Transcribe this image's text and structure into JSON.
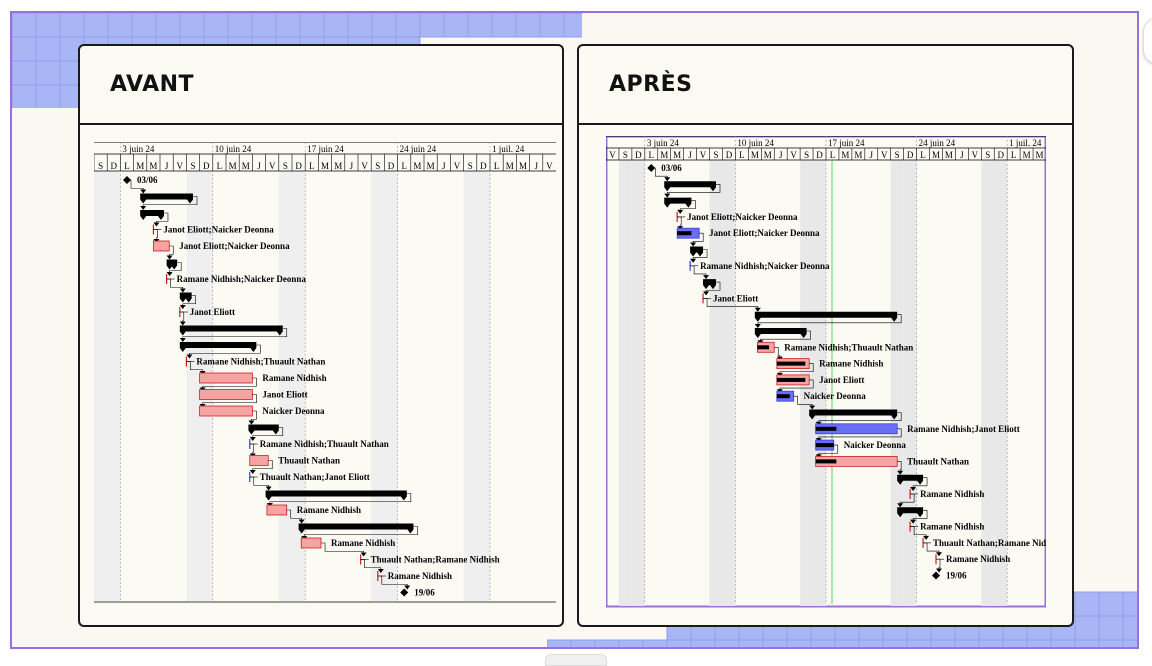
{
  "panels": {
    "before": {
      "title": "AVANT"
    },
    "after": {
      "title": "APRÈS"
    }
  },
  "timeline": {
    "weeks": [
      "3 juin 24",
      "10 juin 24",
      "17 juin 24",
      "24 juin 24",
      "1 juil. 24"
    ],
    "before_days": [
      "S",
      "D",
      "L",
      "M",
      "M",
      "J",
      "V",
      "S",
      "D",
      "L",
      "M",
      "M",
      "J",
      "V",
      "S",
      "D",
      "L",
      "M",
      "M",
      "J",
      "V",
      "S",
      "D",
      "L",
      "M",
      "M",
      "J",
      "V",
      "S",
      "D",
      "L",
      "M",
      "M",
      "J",
      "V"
    ],
    "after_days": [
      "V",
      "S",
      "D",
      "L",
      "M",
      "M",
      "J",
      "V",
      "S",
      "D",
      "L",
      "M",
      "M",
      "J",
      "V",
      "S",
      "D",
      "L",
      "M",
      "M",
      "J",
      "V",
      "S",
      "D",
      "L",
      "M",
      "M",
      "J",
      "V",
      "S",
      "D",
      "L",
      "M",
      "M"
    ]
  },
  "colors": {
    "accent_purple": "#9b6ee0",
    "deco_blue": "#a9b6f5",
    "task_pink": "#f5a3a3",
    "task_red_outline": "#cc2020",
    "task_blue": "#3a3ee0",
    "today_line_green": "#33cc33"
  },
  "before_rows": [
    {
      "type": "milestone",
      "label": "03/06"
    },
    {
      "type": "summary"
    },
    {
      "type": "summary"
    },
    {
      "type": "tick",
      "label": "Janot Eliott;Naicker Deonna"
    },
    {
      "type": "bar",
      "label": "Janot Eliott;Naicker Deonna"
    },
    {
      "type": "summary"
    },
    {
      "type": "tick",
      "label": "Ramane Nidhish;Naicker Deonna"
    },
    {
      "type": "summary"
    },
    {
      "type": "tick",
      "label": "Janot Eliott"
    },
    {
      "type": "summary"
    },
    {
      "type": "summary"
    },
    {
      "type": "tick",
      "label": "Ramane Nidhish;Thuault Nathan"
    },
    {
      "type": "bar",
      "label": "Ramane Nidhish"
    },
    {
      "type": "bar",
      "label": "Janot Eliott"
    },
    {
      "type": "bar",
      "label": "Naicker Deonna"
    },
    {
      "type": "summary"
    },
    {
      "type": "tick",
      "label": "Ramane Nidhish;Thuault Nathan"
    },
    {
      "type": "bar",
      "label": "Thuault Nathan"
    },
    {
      "type": "tick",
      "label": "Thuault Nathan;Janot Eliott"
    },
    {
      "type": "summary"
    },
    {
      "type": "bar",
      "label": "Ramane Nidhish"
    },
    {
      "type": "summary"
    },
    {
      "type": "bar",
      "label": "Ramane Nidhish"
    },
    {
      "type": "tick",
      "label": "Thuault Nathan;Ramane Nidhish"
    },
    {
      "type": "tick",
      "label": "Ramane Nidhish"
    },
    {
      "type": "milestone",
      "label": "19/06"
    }
  ],
  "after_rows": [
    {
      "type": "milestone",
      "label": "03/06"
    },
    {
      "type": "summary"
    },
    {
      "type": "summary"
    },
    {
      "type": "tick",
      "label": "Janot Eliott;Naicker Deonna"
    },
    {
      "type": "bar",
      "label": "Janot Eliott;Naicker Deonna"
    },
    {
      "type": "summary"
    },
    {
      "type": "tick",
      "label": "Ramane Nidhish;Naicker Deonna"
    },
    {
      "type": "summary"
    },
    {
      "type": "tick",
      "label": "Janot Eliott"
    },
    {
      "type": "summary"
    },
    {
      "type": "summary"
    },
    {
      "type": "bar",
      "label": "Ramane Nidhish;Thuault Nathan"
    },
    {
      "type": "bar",
      "label": "Ramane Nidhish"
    },
    {
      "type": "bar",
      "label": "Janot Eliott"
    },
    {
      "type": "bar",
      "label": "Naicker Deonna"
    },
    {
      "type": "summary"
    },
    {
      "type": "bar",
      "label": "Ramane Nidhish;Janot Eliott"
    },
    {
      "type": "bar",
      "label": "Naicker Deonna"
    },
    {
      "type": "bar",
      "label": "Thuault Nathan"
    },
    {
      "type": "summary"
    },
    {
      "type": "tick",
      "label": "Ramane Nidhish"
    },
    {
      "type": "summary"
    },
    {
      "type": "tick",
      "label": "Ramane Nidhish"
    },
    {
      "type": "tick",
      "label": "Thuault Nathan;Ramane Nidhish"
    },
    {
      "type": "tick",
      "label": "Ramane Nidhish"
    },
    {
      "type": "milestone",
      "label": "19/06"
    }
  ]
}
